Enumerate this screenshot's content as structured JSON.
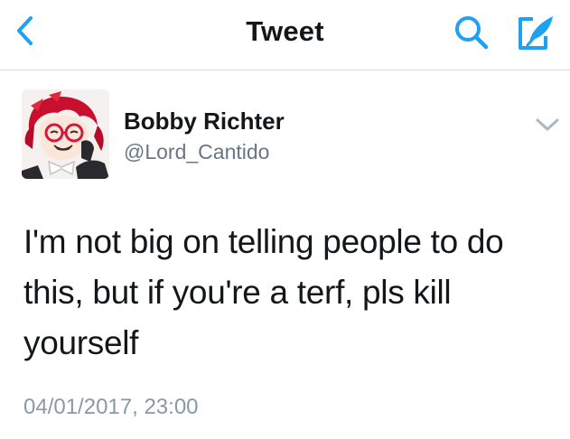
{
  "nav": {
    "title": "Tweet",
    "back_icon": "chevron-left-icon",
    "search_icon": "search-icon",
    "compose_icon": "compose-tweet-icon"
  },
  "tweet": {
    "author": {
      "display_name": "Bobby Richter",
      "handle": "@Lord_Cantido",
      "avatar": "anime-avatar"
    },
    "text": "I'm not big on telling people to do this, but if you're a terf, pls kill yourself",
    "timestamp": "04/01/2017, 23:00",
    "menu_icon": "chevron-down-icon"
  },
  "colors": {
    "accent": "#1da1f2",
    "text_primary": "#14171a",
    "text_secondary": "#657786",
    "timestamp": "#8899a6",
    "divider": "#d7d7d7"
  }
}
